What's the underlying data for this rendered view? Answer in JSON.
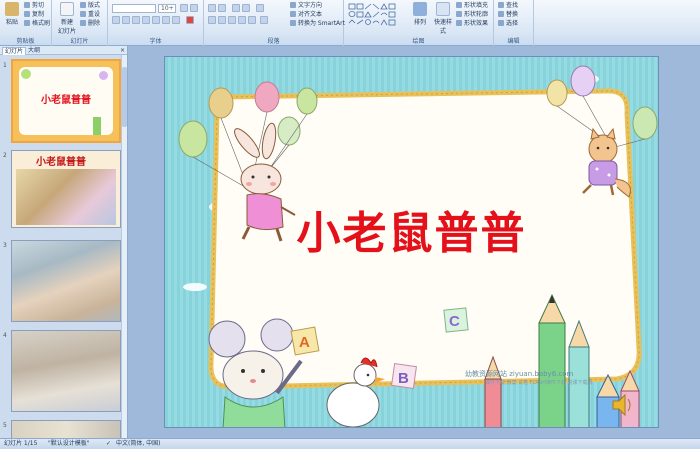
{
  "ribbon": {
    "clipboard": {
      "paste": "粘贴",
      "cut": "剪切",
      "copy": "复制",
      "format_painter": "格式刷",
      "label": "剪贴板"
    },
    "slides": {
      "new_slide": "新建",
      "new_slide2": "幻灯片",
      "layout": "版式",
      "reset": "重设",
      "delete": "删除",
      "label": "幻灯片"
    },
    "font": {
      "size": "10+",
      "label": "字体"
    },
    "paragraph": {
      "text_direction": "文字方向",
      "align_text": "对齐文本",
      "smartart": "转换为 SmartArt",
      "label": "段落"
    },
    "drawing": {
      "arrange": "排列",
      "quick_styles": "快速样式",
      "fill": "形状填充",
      "outline": "形状轮廓",
      "effects": "形状效果",
      "label": "绘图"
    },
    "editing": {
      "find": "查找",
      "replace": "替换",
      "select": "选择",
      "label": "编辑"
    }
  },
  "panel": {
    "tab_slides": "幻灯片",
    "tab_outline": "大纲",
    "close": "×",
    "thumbs": [
      {
        "num": "1",
        "title": "小老鼠普普"
      },
      {
        "num": "2",
        "title": "小老鼠普普"
      },
      {
        "num": "3"
      },
      {
        "num": "4"
      },
      {
        "num": "5"
      }
    ]
  },
  "slide": {
    "title": "小老鼠普普",
    "watermark": "幼教资源网站 ziyuan.baby6.com",
    "watermark_sub": "课件下载  教案  试卷  FLASH课件下载  说课下载网",
    "letters": [
      "A",
      "B",
      "C"
    ]
  },
  "status": {
    "slide_count": "幻灯片 1/15",
    "theme": "\"默认设计模板\"",
    "language": "中文(简体, 中国)"
  },
  "colors": {
    "title": "#e4101a",
    "background": "#8fd7de",
    "frame": "#e9c15a"
  }
}
